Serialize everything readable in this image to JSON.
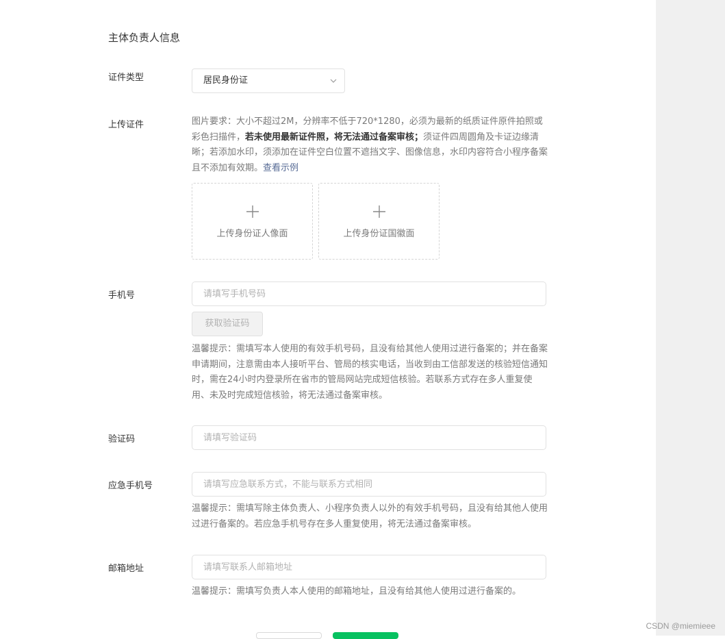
{
  "section_title": "主体负责人信息",
  "id_type": {
    "label": "证件类型",
    "value": "居民身份证"
  },
  "upload": {
    "label": "上传证件",
    "hint_plain_1": "图片要求：大小不超过2M，分辨率不低于720*1280，必须为最新的纸质证件原件拍照或彩色扫描件，",
    "hint_bold": "若未使用最新证件照，将无法通过备案审核；",
    "hint_plain_2": "须证件四周圆角及卡证边缘清晰；若添加水印，须添加在证件空白位置不遮挡文字、图像信息，水印内容符合小程序备案且不添加有效期。",
    "hint_link": "查看示例",
    "front_label": "上传身份证人像面",
    "back_label": "上传身份证国徽面"
  },
  "phone": {
    "label": "手机号",
    "placeholder": "请填写手机号码",
    "code_button": "获取验证码",
    "hint": "温馨提示：需填写本人使用的有效手机号码，且没有给其他人使用过进行备案的；并在备案申请期间，注意需由本人接听平台、管局的核实电话，当收到由工信部发送的核验短信通知时，需在24小时内登录所在省市的管局网站完成短信核验。若联系方式存在多人重复使用、未及时完成短信核验，将无法通过备案审核。"
  },
  "verify_code": {
    "label": "验证码",
    "placeholder": "请填写验证码"
  },
  "emergency_phone": {
    "label": "应急手机号",
    "placeholder": "请填写应急联系方式，不能与联系方式相同",
    "hint": "温馨提示：需填写除主体负责人、小程序负责人以外的有效手机号码，且没有给其他人使用过进行备案的。若应急手机号存在多人重复使用，将无法通过备案审核。"
  },
  "email": {
    "label": "邮箱地址",
    "placeholder": "请填写联系人邮箱地址",
    "hint": "温馨提示：需填写负责人本人使用的邮箱地址，且没有给其他人使用过进行备案的。"
  },
  "watermark": "CSDN @miemieee",
  "colors": {
    "accent_green": "#07c160",
    "link": "#576b95",
    "side_panel": "#f0f0f0"
  }
}
